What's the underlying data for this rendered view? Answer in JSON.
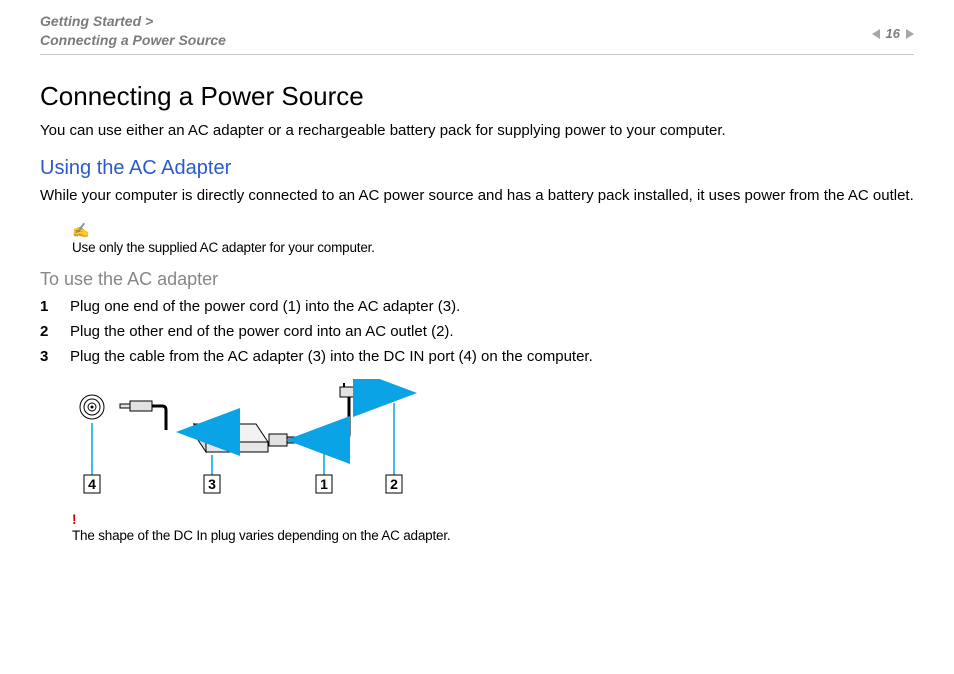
{
  "header": {
    "breadcrumb_line1": "Getting Started >",
    "breadcrumb_line2": "Connecting a Power Source",
    "page_number": "16"
  },
  "title": "Connecting a Power Source",
  "intro": "You can use either an AC adapter or a rechargeable battery pack for supplying power to your computer.",
  "section": {
    "heading": "Using the AC Adapter",
    "body": "While your computer is directly connected to an AC power source and has a battery pack installed, it uses power from the AC outlet."
  },
  "note": {
    "icon": "✍",
    "text": "Use only the supplied AC adapter for your computer."
  },
  "subheading": "To use the AC adapter",
  "steps": [
    {
      "n": "1",
      "text": "Plug one end of the power cord (1) into the AC adapter (3)."
    },
    {
      "n": "2",
      "text": "Plug the other end of the power cord into an AC outlet (2)."
    },
    {
      "n": "3",
      "text": "Plug the cable from the AC adapter (3) into the DC IN port (4) on the computer."
    }
  ],
  "diagram_labels": {
    "l1": "1",
    "l2": "2",
    "l3": "3",
    "l4": "4"
  },
  "caution": {
    "mark": "!",
    "text": "The shape of the DC In plug varies depending on the AC adapter."
  }
}
